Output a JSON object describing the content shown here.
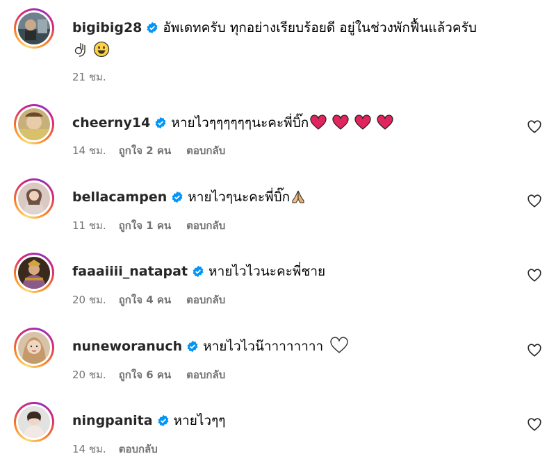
{
  "comments": [
    {
      "username": "bigibig28",
      "text": "อัพเดทครับ ทุกอย่างเรียบร้อยดี อยู่ในช่วงพักฟื้นแล้วครับ",
      "time": "21 ชม."
    },
    {
      "username": "cheerny14",
      "text": "หายไวๆๆๆๆๆๆนะคะพี่บิ๊ก",
      "time": "14 ชม.",
      "likes": "ถูกใจ 2 คน",
      "reply": "ตอบกลับ"
    },
    {
      "username": "bellacampen",
      "text": "หายไวๆนะคะพี่บิ๊ก",
      "time": "11 ชม.",
      "likes": "ถูกใจ 1 คน",
      "reply": "ตอบกลับ"
    },
    {
      "username": "faaaiiii_natapat",
      "text": "หายไวไวนะคะพี่ชาย",
      "time": "20 ชม.",
      "likes": "ถูกใจ 4 คน",
      "reply": "ตอบกลับ"
    },
    {
      "username": "nuneworanuch",
      "text": "หายไวไวน๊าาาาาาาา",
      "time": "20 ชม.",
      "likes": "ถูกใจ 6 คน",
      "reply": "ตอบกลับ"
    },
    {
      "username": "ningpanita",
      "text": "หายไวๆๆ",
      "time": "14 ชม.",
      "reply": "ตอบกลับ"
    }
  ],
  "icons": {
    "verified": "verified-badge-icon",
    "like": "heart-outline-icon"
  },
  "colors": {
    "verified": "#0095f6",
    "meta": "#737373",
    "heart_emoji": "#e0245e"
  }
}
